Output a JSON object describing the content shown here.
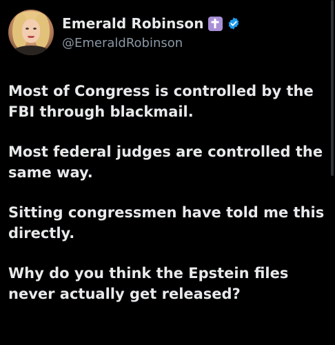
{
  "author": {
    "name": "Emerald Robinson",
    "handle": "@EmeraldRobinson",
    "badge_icon": "cross-icon",
    "verified_icon": "verified-check-icon",
    "badge_color": "#a98fd6",
    "verified_color": "#1d9bf0"
  },
  "tweet": {
    "paragraphs": [
      "Most of Congress is controlled by the FBI through blackmail.",
      "Most federal judges are controlled the same way.",
      "Sitting congressmen have told me this directly.",
      "Why do you think the Epstein files never actually get released?"
    ]
  }
}
